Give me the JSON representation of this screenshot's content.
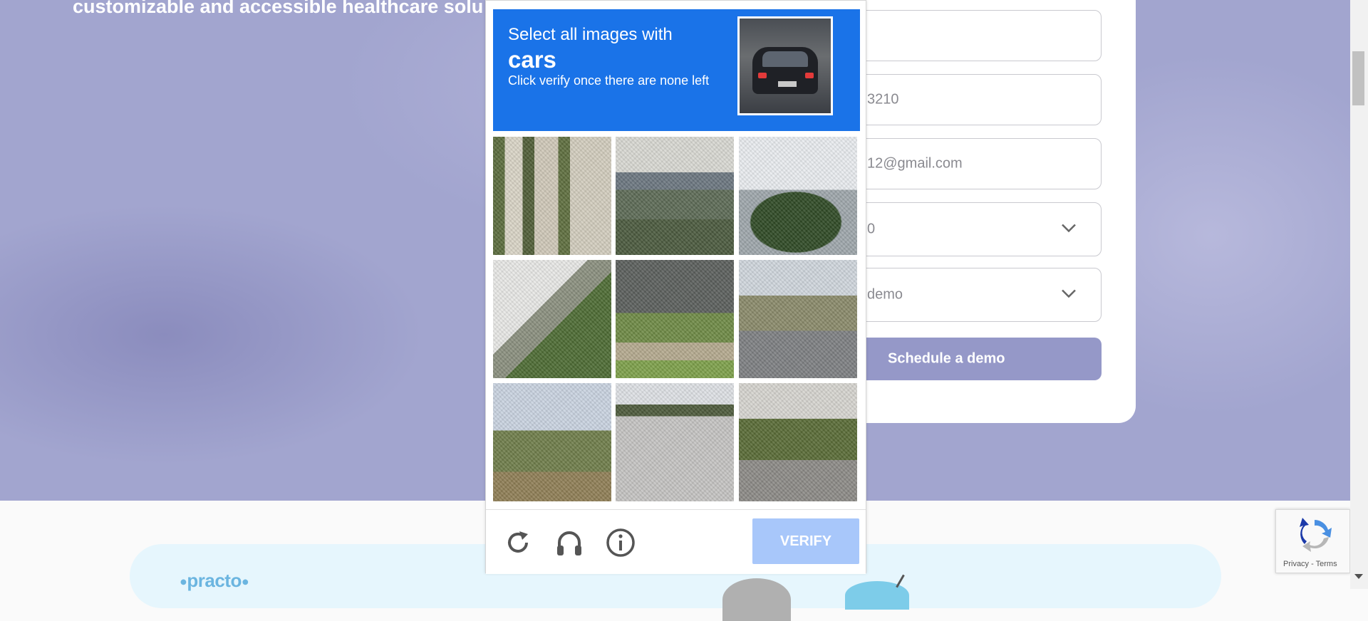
{
  "hero": {
    "heading": "customizable and accessible healthcare solu"
  },
  "form": {
    "fields": [
      {
        "value": "",
        "type": "text"
      },
      {
        "value": "3210",
        "type": "text"
      },
      {
        "value": "12@gmail.com",
        "type": "text"
      },
      {
        "value": "0",
        "type": "select"
      },
      {
        "value": "demo",
        "type": "select"
      }
    ],
    "submit_label": "Schedule a demo"
  },
  "captcha": {
    "prompt_line1": "Select all images with",
    "target": "cars",
    "instruction": "Click verify once there are none left",
    "sample_icon": "car-rear-icon",
    "tiles": [
      {
        "name": "trees-building-tile",
        "selected": false
      },
      {
        "name": "overpass-tile",
        "selected": false
      },
      {
        "name": "tree-streetlight-tile",
        "selected": false
      },
      {
        "name": "stairs-railing-tile",
        "selected": false
      },
      {
        "name": "fence-garden-tile",
        "selected": false
      },
      {
        "name": "road-sign-car-tile",
        "selected": false
      },
      {
        "name": "palm-bushes-tile",
        "selected": false
      },
      {
        "name": "road-curb-tile",
        "selected": false
      },
      {
        "name": "palm-road-tile",
        "selected": false
      }
    ],
    "verify_label": "VERIFY",
    "icons": {
      "reload": "reload-icon",
      "audio": "headphones-icon",
      "info": "info-icon"
    }
  },
  "recaptcha_badge": {
    "links": "Privacy - Terms"
  },
  "footer": {
    "logo": "practo"
  },
  "colors": {
    "hero_bg": "#a2a5cf",
    "captcha_header": "#1a73e8",
    "verify_button": "#a8c7fa",
    "schedule_button": "#9598c8"
  }
}
